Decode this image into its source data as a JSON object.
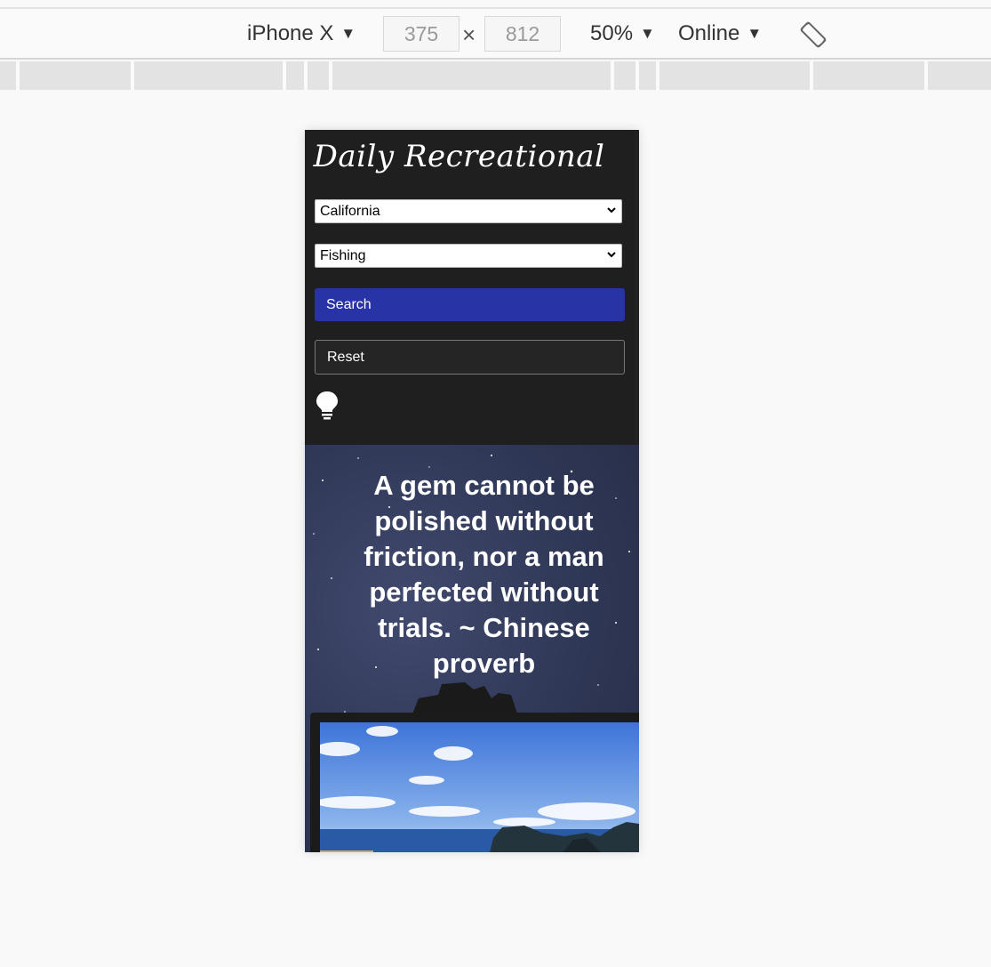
{
  "toolbar": {
    "device": "iPhone X",
    "width": "375",
    "height": "812",
    "times": "×",
    "zoom": "50%",
    "network": "Online",
    "caret": "▼"
  },
  "app": {
    "logo": "Daily Recreational",
    "state_select": "California",
    "activity_select": "Fishing",
    "search_label": "Search",
    "reset_label": "Reset",
    "quote": "A gem cannot be polished without friction, nor a man perfected without trials. ~ Chinese proverb"
  },
  "colors": {
    "search_button": "#2833a6",
    "header_bg": "#1f1f1f"
  },
  "icons": [
    "lightbulb-icon",
    "rotate-icon",
    "chevron-down-icon"
  ]
}
